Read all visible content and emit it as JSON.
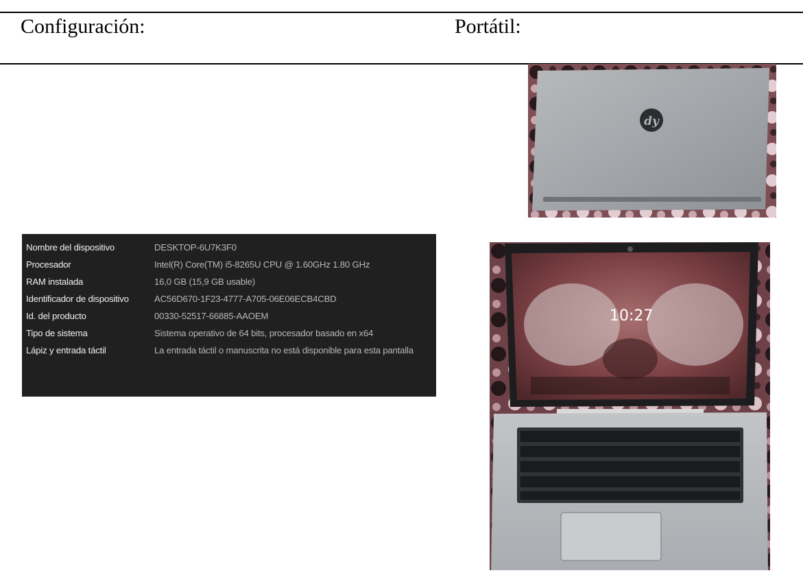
{
  "headings": {
    "left": "Configuración:",
    "right": "Portátil:"
  },
  "specs": [
    {
      "label": "Nombre del dispositivo",
      "value": "DESKTOP-6U7K3F0"
    },
    {
      "label": "Procesador",
      "value": "Intel(R) Core(TM) i5-8265U CPU @ 1.60GHz   1.80 GHz"
    },
    {
      "label": "RAM instalada",
      "value": "16,0 GB (15,9 GB usable)"
    },
    {
      "label": "Identificador de dispositivo",
      "value": "AC56D670-1F23-4777-A705-06E06ECB4CBD"
    },
    {
      "label": "Id. del producto",
      "value": "00330-52517-66885-AAOEM"
    },
    {
      "label": "Tipo de sistema",
      "value": "Sistema operativo de 64 bits, procesador basado en x64"
    },
    {
      "label": "Lápiz y entrada táctil",
      "value": "La entrada táctil o manuscrita no está disponible para esta pantalla"
    }
  ],
  "photos": {
    "lid_logo": "dy",
    "lock_screen_time": "10:27"
  },
  "colors": {
    "panel_bg": "#202020",
    "label_text": "#f2f2f2",
    "value_text": "#b8b8b8"
  }
}
